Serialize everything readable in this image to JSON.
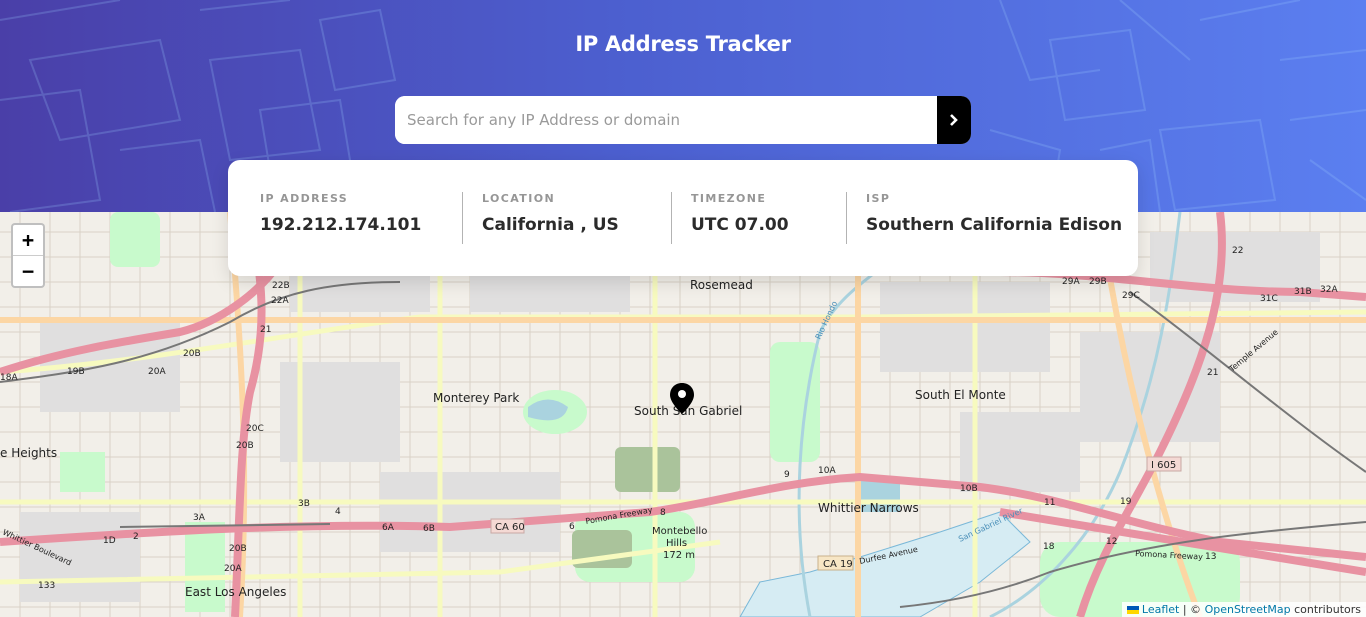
{
  "header": {
    "title": "IP Address Tracker"
  },
  "search": {
    "placeholder": "Search for any IP Address or domain",
    "value": "",
    "submit_icon": "chevron-right-icon"
  },
  "info": {
    "ip": {
      "label": "IP ADDRESS",
      "value": "192.212.174.101"
    },
    "location": {
      "label": "LOCATION",
      "value": "California , US"
    },
    "timezone": {
      "label": "TIMEZONE",
      "value": "UTC 07.00"
    },
    "isp": {
      "label": "ISP",
      "value": "Southern California Edison"
    }
  },
  "map": {
    "zoom_in": "+",
    "zoom_out": "−",
    "marker_icon": "location-pin-icon",
    "places": {
      "rosemead": "Rosemead",
      "monterey_park": "Monterey Park",
      "south_san_gabriel": "South San Gabriel",
      "south_el_monte": "South El Monte",
      "whittier_narrows": "Whittier Narrows",
      "east_los_angeles": "East Los Angeles",
      "montebello_hills": "Montebello",
      "montebello_hills_2": "Hills",
      "montebello_elev": "172 m",
      "heights": "e Heights",
      "heights_top": "H"
    },
    "road_labels": {
      "ca60": "CA 60",
      "ca19": "CA 19",
      "i605": "I 605",
      "pomona_fwy": "Pomona Freeway",
      "pomona_fwy_2": "Pomona Freeway",
      "durfee": "Durfee Avenue",
      "whittier_blvd": "Whittier Boulevard",
      "san_gabriel_river": "San Gabriel River",
      "rio_hondo": "Rio Hondo",
      "temple_ave": "Temple Avenue"
    },
    "exits": [
      "22B",
      "22A",
      "21",
      "20B",
      "20A",
      "19B",
      "18A",
      "20C",
      "20B",
      "3A",
      "3B",
      "4",
      "6A",
      "6B",
      "1D",
      "2",
      "20B",
      "20A",
      "133",
      "8",
      "9",
      "10A",
      "10B",
      "11",
      "12",
      "13",
      "18",
      "19",
      "29A",
      "29B",
      "29C",
      "31C",
      "31B",
      "32A",
      "22",
      "21",
      "6"
    ]
  },
  "attribution": {
    "leaflet": "Leaflet",
    "separator": "| ©",
    "osm": "OpenStreetMap",
    "contributors": "contributors"
  },
  "colors": {
    "header_start": "#4a3fa8",
    "header_end": "#5b7ff0",
    "motorway": "#e892a2",
    "trunk": "#f9b29c",
    "primary": "#fcd6a4",
    "secondary": "#f7fabf",
    "water": "#aad3df",
    "park": "#c8facc"
  }
}
